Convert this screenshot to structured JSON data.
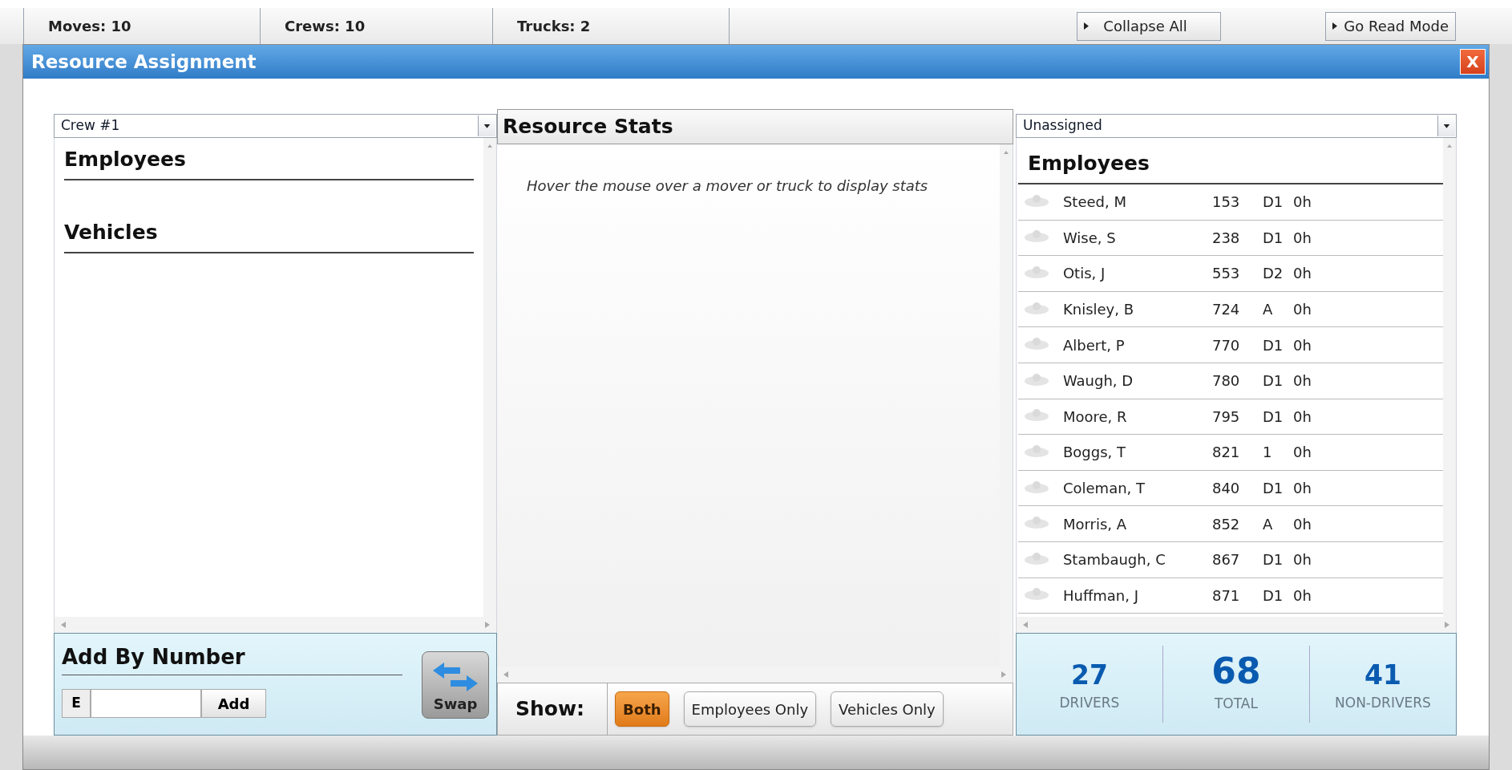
{
  "top_bar": {
    "stats": [
      "Moves: 10",
      "Crews: 10",
      "Trucks: 2"
    ],
    "buttons": [
      "Collapse All",
      "Go Read Mode"
    ]
  },
  "dialog": {
    "title": "Resource Assignment",
    "close": "X"
  },
  "left_panel": {
    "select": "Crew #1",
    "sections": [
      "Employees",
      "Vehicles"
    ]
  },
  "add_by_number": {
    "title": "Add By Number",
    "prefix": "E",
    "add_button": "Add",
    "swap_button": "Swap"
  },
  "stats_panel": {
    "title": "Resource Stats",
    "hint": "Hover the mouse over a mover or truck to display stats",
    "show_label": "Show:",
    "filters": [
      {
        "label": "Both",
        "selected": true
      },
      {
        "label": "Employees Only",
        "selected": false
      },
      {
        "label": "Vehicles Only",
        "selected": false
      }
    ]
  },
  "right_panel": {
    "select": "Unassigned",
    "title": "Employees",
    "rows": [
      {
        "name": "Steed, M",
        "number": "153",
        "class": "D1",
        "hours": "0h"
      },
      {
        "name": "Wise, S",
        "number": "238",
        "class": "D1",
        "hours": "0h"
      },
      {
        "name": "Otis, J",
        "number": "553",
        "class": "D2",
        "hours": "0h"
      },
      {
        "name": "Knisley, B",
        "number": "724",
        "class": "A",
        "hours": "0h"
      },
      {
        "name": "Albert, P",
        "number": "770",
        "class": "D1",
        "hours": "0h"
      },
      {
        "name": "Waugh, D",
        "number": "780",
        "class": "D1",
        "hours": "0h"
      },
      {
        "name": "Moore, R",
        "number": "795",
        "class": "D1",
        "hours": "0h"
      },
      {
        "name": "Boggs, T",
        "number": "821",
        "class": "1",
        "hours": "0h"
      },
      {
        "name": "Coleman, T",
        "number": "840",
        "class": "D1",
        "hours": "0h"
      },
      {
        "name": "Morris, A",
        "number": "852",
        "class": "A",
        "hours": "0h"
      },
      {
        "name": "Stambaugh, C",
        "number": "867",
        "class": "D1",
        "hours": "0h"
      },
      {
        "name": "Huffman, J",
        "number": "871",
        "class": "D1",
        "hours": "0h"
      }
    ],
    "summary": [
      {
        "value": "27",
        "label": "DRIVERS",
        "kind": "side"
      },
      {
        "value": "68",
        "label": "TOTAL",
        "kind": "main"
      },
      {
        "value": "41",
        "label": "NON-DRIVERS",
        "kind": "side"
      }
    ]
  }
}
